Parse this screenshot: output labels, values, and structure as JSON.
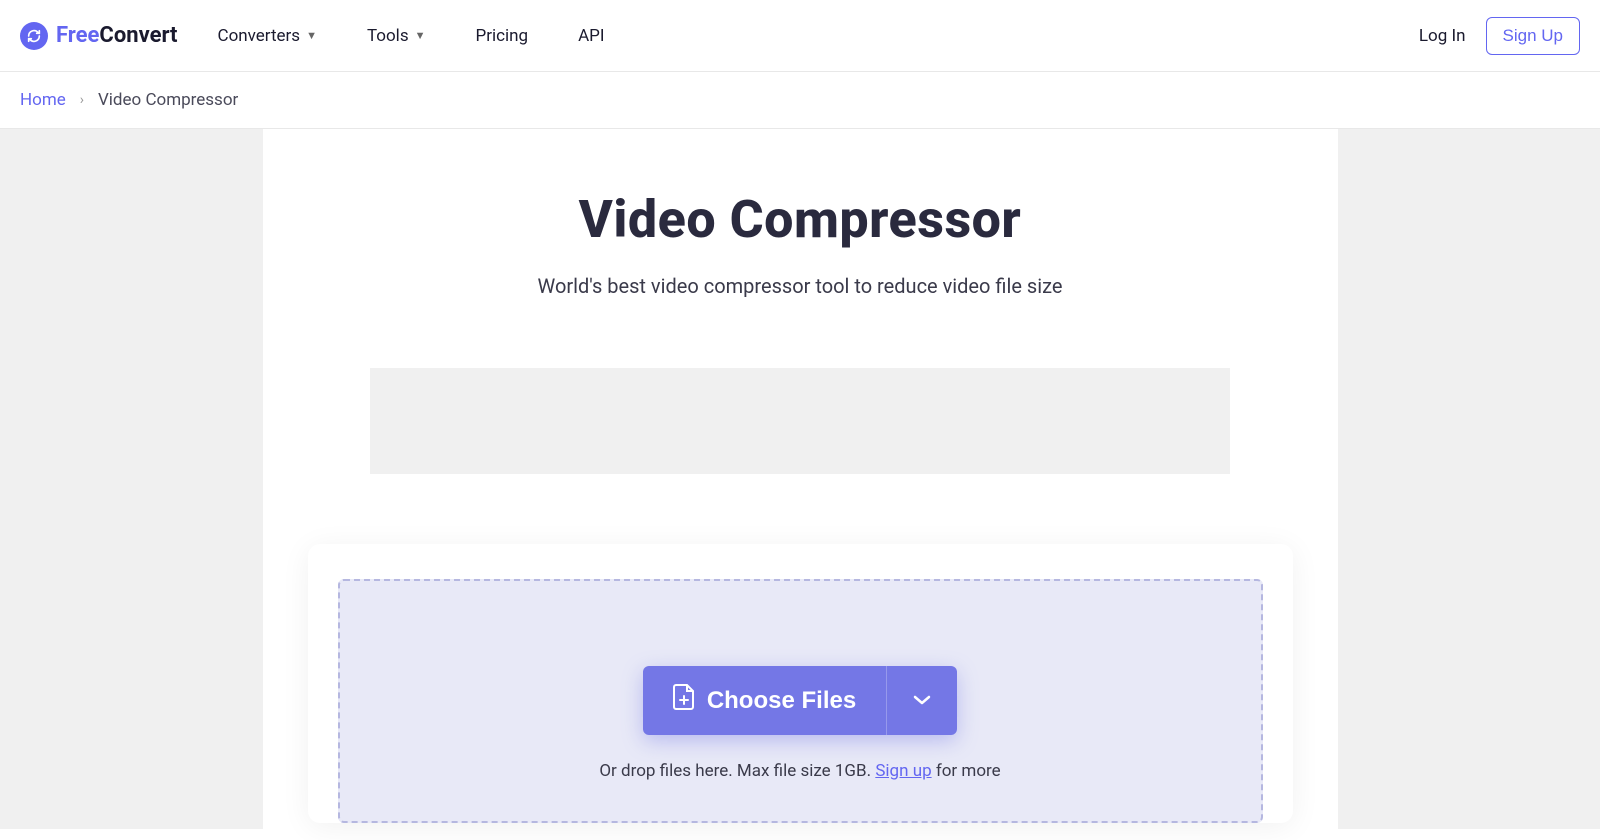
{
  "header": {
    "logo": {
      "part1": "Free",
      "part2": "Convert"
    },
    "nav": [
      {
        "label": "Converters",
        "hasDropdown": true
      },
      {
        "label": "Tools",
        "hasDropdown": true
      },
      {
        "label": "Pricing",
        "hasDropdown": false
      },
      {
        "label": "API",
        "hasDropdown": false
      }
    ],
    "login": "Log In",
    "signup": "Sign Up"
  },
  "breadcrumb": {
    "home": "Home",
    "current": "Video Compressor"
  },
  "main": {
    "title": "Video Compressor",
    "subtitle": "World's best video compressor tool to reduce video file size"
  },
  "upload": {
    "choose_label": "Choose Files",
    "drop_prefix": "Or drop files here. Max file size 1GB. ",
    "signup_link": "Sign up",
    "drop_suffix": " for more"
  }
}
